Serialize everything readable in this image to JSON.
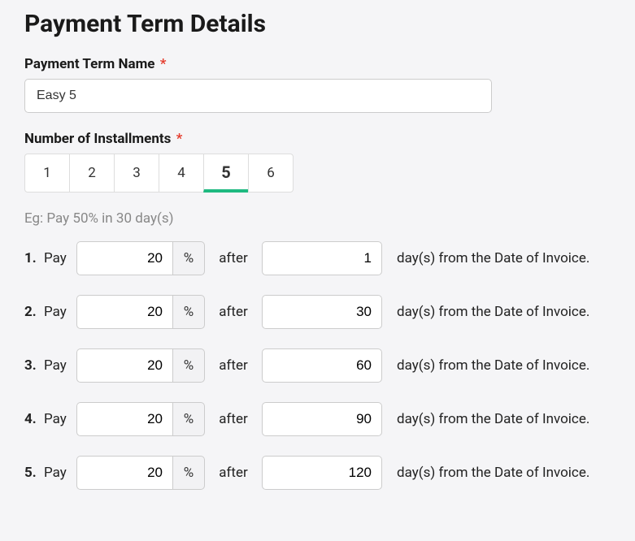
{
  "title": "Payment Term Details",
  "fields": {
    "name_label": "Payment Term Name",
    "name_value": "Easy 5",
    "installments_label": "Number of Installments"
  },
  "tabs": [
    "1",
    "2",
    "3",
    "4",
    "5",
    "6"
  ],
  "selected_tab": "5",
  "example": "Eg: Pay 50% in 30 day(s)",
  "row_labels": {
    "pay": "Pay",
    "percent": "%",
    "after": "after",
    "suffix": "day(s) from the Date of Invoice."
  },
  "rows": [
    {
      "num": "1.",
      "percent": "20",
      "days": "1"
    },
    {
      "num": "2.",
      "percent": "20",
      "days": "30"
    },
    {
      "num": "3.",
      "percent": "20",
      "days": "60"
    },
    {
      "num": "4.",
      "percent": "20",
      "days": "90"
    },
    {
      "num": "5.",
      "percent": "20",
      "days": "120"
    }
  ]
}
